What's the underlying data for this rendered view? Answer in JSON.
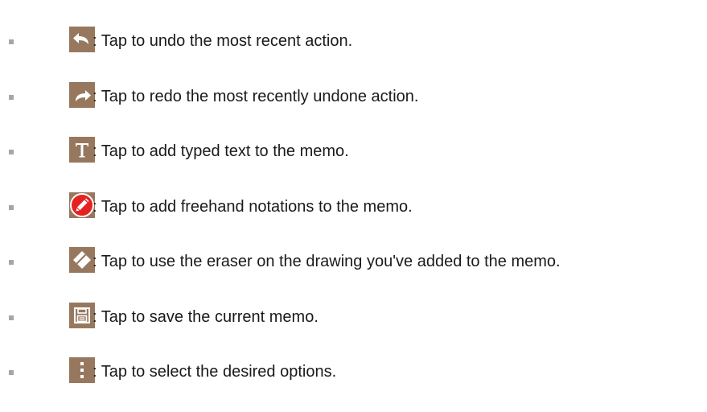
{
  "colors": {
    "icon_tile": "#97785f",
    "pen_red": "#e52222",
    "bullet": "#a6a6a6",
    "text": "#1a1a1a"
  },
  "items": [
    {
      "icon": "undo-icon",
      "text": ": Tap to undo the most recent action."
    },
    {
      "icon": "redo-icon",
      "text": ": Tap to redo the most recently undone action."
    },
    {
      "icon": "text-icon",
      "text": ": Tap to add typed text to the memo."
    },
    {
      "icon": "pen-icon",
      "text": ": Tap to add freehand notations to the memo."
    },
    {
      "icon": "eraser-icon",
      "text": ": Tap to use the eraser on the drawing you've added to the memo."
    },
    {
      "icon": "save-icon",
      "text": ": Tap to save the current memo."
    },
    {
      "icon": "more-options-icon",
      "text": ": Tap to select the desired options."
    }
  ]
}
